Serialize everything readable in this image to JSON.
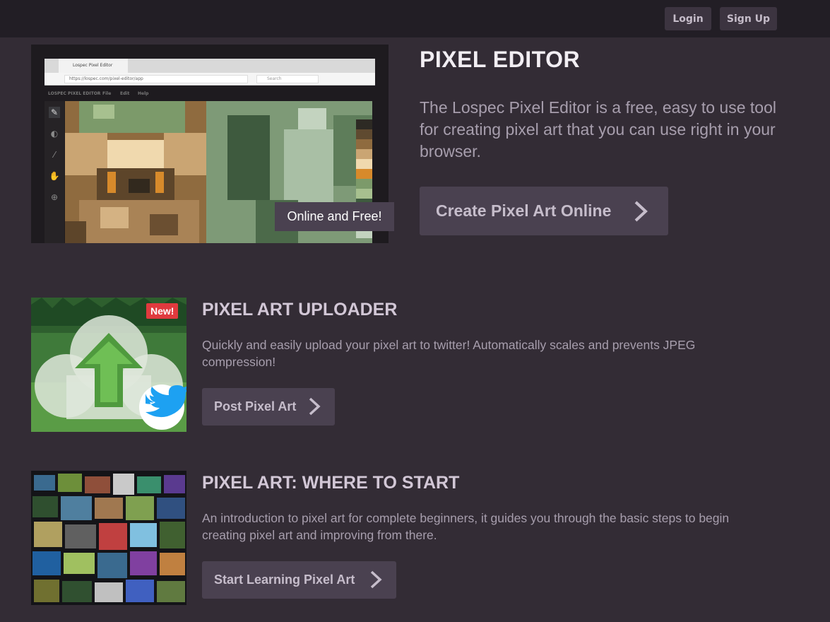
{
  "nav": {
    "login_label": "Login",
    "signup_label": "Sign Up"
  },
  "hero": {
    "title": "PIXEL EDITOR",
    "description": "The Lospec Pixel Editor is a free, easy to use tool for creating pixel art that you can use right in your browser.",
    "cta_label": "Create Pixel Art Online",
    "overlay_tag": "Online and Free!",
    "screenshot": {
      "tab_title": "Lospec Pixel Editor",
      "address": "https://lospec.com/pixel-editor/app",
      "search_placeholder": "Search",
      "menu": [
        "LOSPEC PIXEL EDITOR",
        "File",
        "Edit",
        "Help"
      ]
    }
  },
  "features": [
    {
      "title": "PIXEL ART UPLOADER",
      "description": "Quickly and easily upload your pixel art to twitter! Automatically scales and prevents JPEG compression!",
      "cta_label": "Post Pixel Art",
      "badge": "New!"
    },
    {
      "title": "PIXEL ART: WHERE TO START",
      "description": "An introduction to pixel art for complete beginners, it guides you through the basic steps to begin creating pixel art and improving from there.",
      "cta_label": "Start Learning Pixel Art"
    }
  ],
  "colors": {
    "background": "#332c35",
    "topbar": "#221e25",
    "button": "#4a4150",
    "badge": "#e03a3e"
  },
  "icons": [
    "pencil-icon",
    "fill-icon",
    "eyedropper-icon",
    "hand-icon",
    "zoom-icon",
    "chevron-right-icon",
    "upload-arrow-icon",
    "cloud-icon",
    "twitter-bird-icon"
  ]
}
